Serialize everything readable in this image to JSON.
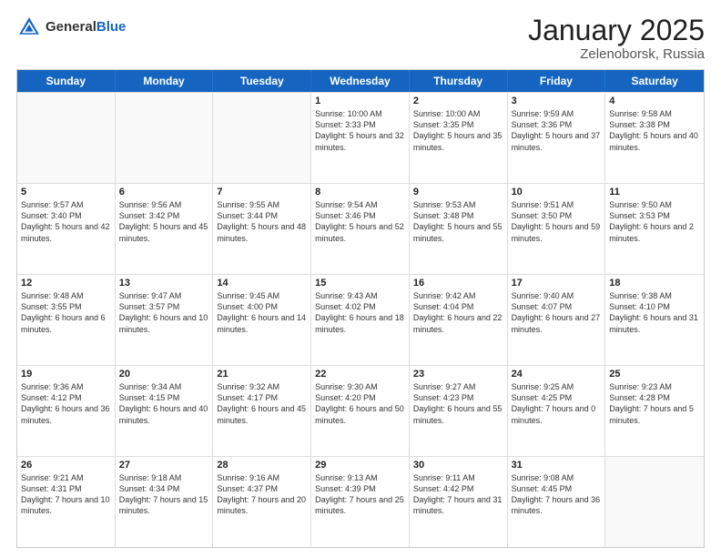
{
  "header": {
    "logo_general": "General",
    "logo_blue": "Blue",
    "month_year": "January 2025",
    "location": "Zelenoborsk, Russia"
  },
  "weekdays": [
    "Sunday",
    "Monday",
    "Tuesday",
    "Wednesday",
    "Thursday",
    "Friday",
    "Saturday"
  ],
  "rows": [
    [
      {
        "day": "",
        "info": ""
      },
      {
        "day": "",
        "info": ""
      },
      {
        "day": "",
        "info": ""
      },
      {
        "day": "1",
        "info": "Sunrise: 10:00 AM\nSunset: 3:33 PM\nDaylight: 5 hours and 32 minutes."
      },
      {
        "day": "2",
        "info": "Sunrise: 10:00 AM\nSunset: 3:35 PM\nDaylight: 5 hours and 35 minutes."
      },
      {
        "day": "3",
        "info": "Sunrise: 9:59 AM\nSunset: 3:36 PM\nDaylight: 5 hours and 37 minutes."
      },
      {
        "day": "4",
        "info": "Sunrise: 9:58 AM\nSunset: 3:38 PM\nDaylight: 5 hours and 40 minutes."
      }
    ],
    [
      {
        "day": "5",
        "info": "Sunrise: 9:57 AM\nSunset: 3:40 PM\nDaylight: 5 hours and 42 minutes."
      },
      {
        "day": "6",
        "info": "Sunrise: 9:56 AM\nSunset: 3:42 PM\nDaylight: 5 hours and 45 minutes."
      },
      {
        "day": "7",
        "info": "Sunrise: 9:55 AM\nSunset: 3:44 PM\nDaylight: 5 hours and 48 minutes."
      },
      {
        "day": "8",
        "info": "Sunrise: 9:54 AM\nSunset: 3:46 PM\nDaylight: 5 hours and 52 minutes."
      },
      {
        "day": "9",
        "info": "Sunrise: 9:53 AM\nSunset: 3:48 PM\nDaylight: 5 hours and 55 minutes."
      },
      {
        "day": "10",
        "info": "Sunrise: 9:51 AM\nSunset: 3:50 PM\nDaylight: 5 hours and 59 minutes."
      },
      {
        "day": "11",
        "info": "Sunrise: 9:50 AM\nSunset: 3:53 PM\nDaylight: 6 hours and 2 minutes."
      }
    ],
    [
      {
        "day": "12",
        "info": "Sunrise: 9:48 AM\nSunset: 3:55 PM\nDaylight: 6 hours and 6 minutes."
      },
      {
        "day": "13",
        "info": "Sunrise: 9:47 AM\nSunset: 3:57 PM\nDaylight: 6 hours and 10 minutes."
      },
      {
        "day": "14",
        "info": "Sunrise: 9:45 AM\nSunset: 4:00 PM\nDaylight: 6 hours and 14 minutes."
      },
      {
        "day": "15",
        "info": "Sunrise: 9:43 AM\nSunset: 4:02 PM\nDaylight: 6 hours and 18 minutes."
      },
      {
        "day": "16",
        "info": "Sunrise: 9:42 AM\nSunset: 4:04 PM\nDaylight: 6 hours and 22 minutes."
      },
      {
        "day": "17",
        "info": "Sunrise: 9:40 AM\nSunset: 4:07 PM\nDaylight: 6 hours and 27 minutes."
      },
      {
        "day": "18",
        "info": "Sunrise: 9:38 AM\nSunset: 4:10 PM\nDaylight: 6 hours and 31 minutes."
      }
    ],
    [
      {
        "day": "19",
        "info": "Sunrise: 9:36 AM\nSunset: 4:12 PM\nDaylight: 6 hours and 36 minutes."
      },
      {
        "day": "20",
        "info": "Sunrise: 9:34 AM\nSunset: 4:15 PM\nDaylight: 6 hours and 40 minutes."
      },
      {
        "day": "21",
        "info": "Sunrise: 9:32 AM\nSunset: 4:17 PM\nDaylight: 6 hours and 45 minutes."
      },
      {
        "day": "22",
        "info": "Sunrise: 9:30 AM\nSunset: 4:20 PM\nDaylight: 6 hours and 50 minutes."
      },
      {
        "day": "23",
        "info": "Sunrise: 9:27 AM\nSunset: 4:23 PM\nDaylight: 6 hours and 55 minutes."
      },
      {
        "day": "24",
        "info": "Sunrise: 9:25 AM\nSunset: 4:25 PM\nDaylight: 7 hours and 0 minutes."
      },
      {
        "day": "25",
        "info": "Sunrise: 9:23 AM\nSunset: 4:28 PM\nDaylight: 7 hours and 5 minutes."
      }
    ],
    [
      {
        "day": "26",
        "info": "Sunrise: 9:21 AM\nSunset: 4:31 PM\nDaylight: 7 hours and 10 minutes."
      },
      {
        "day": "27",
        "info": "Sunrise: 9:18 AM\nSunset: 4:34 PM\nDaylight: 7 hours and 15 minutes."
      },
      {
        "day": "28",
        "info": "Sunrise: 9:16 AM\nSunset: 4:37 PM\nDaylight: 7 hours and 20 minutes."
      },
      {
        "day": "29",
        "info": "Sunrise: 9:13 AM\nSunset: 4:39 PM\nDaylight: 7 hours and 25 minutes."
      },
      {
        "day": "30",
        "info": "Sunrise: 9:11 AM\nSunset: 4:42 PM\nDaylight: 7 hours and 31 minutes."
      },
      {
        "day": "31",
        "info": "Sunrise: 9:08 AM\nSunset: 4:45 PM\nDaylight: 7 hours and 36 minutes."
      },
      {
        "day": "",
        "info": ""
      }
    ]
  ]
}
